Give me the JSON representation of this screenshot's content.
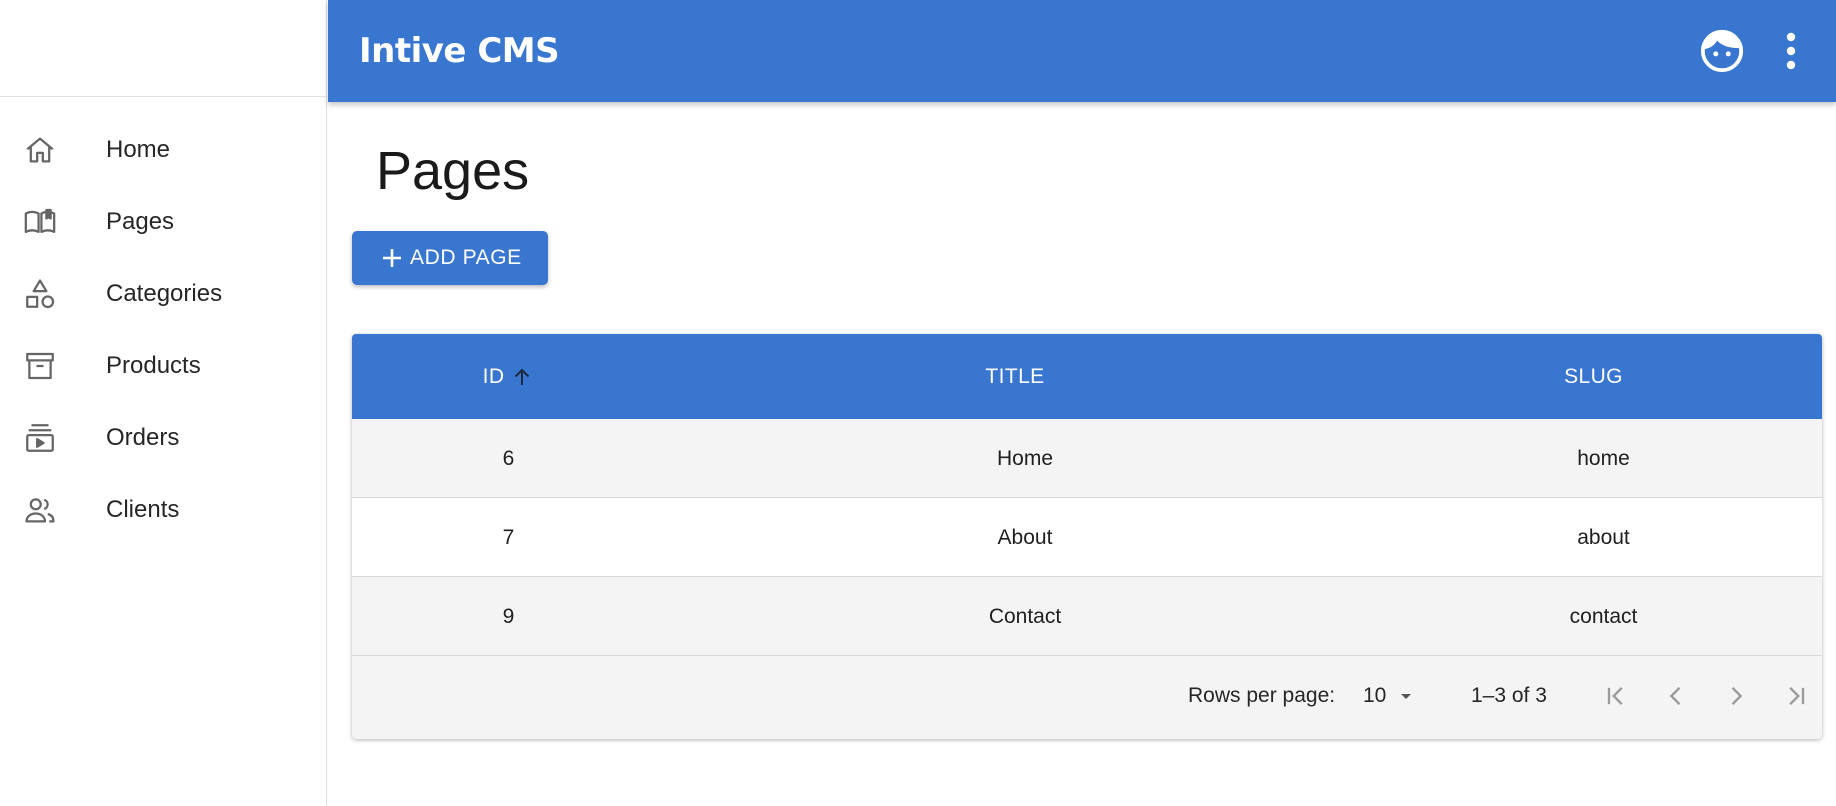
{
  "app": {
    "title": "Intive CMS"
  },
  "sidebar": {
    "items": [
      {
        "label": "Home",
        "icon": "home-icon"
      },
      {
        "label": "Pages",
        "icon": "book-icon"
      },
      {
        "label": "Categories",
        "icon": "shapes-icon"
      },
      {
        "label": "Products",
        "icon": "archive-icon"
      },
      {
        "label": "Orders",
        "icon": "subscriptions-icon"
      },
      {
        "label": "Clients",
        "icon": "people-icon"
      }
    ]
  },
  "main": {
    "title": "Pages",
    "add_button": "ADD PAGE"
  },
  "table": {
    "columns": [
      "ID",
      "TITLE",
      "SLUG"
    ],
    "sorted_by": "ID",
    "rows": [
      {
        "id": "6",
        "title": "Home",
        "slug": "home"
      },
      {
        "id": "7",
        "title": "About",
        "slug": "about"
      },
      {
        "id": "9",
        "title": "Contact",
        "slug": "contact"
      }
    ],
    "pagination": {
      "rows_per_page_label": "Rows per page:",
      "rows_per_page": "10",
      "range": "1–3 of 3"
    }
  },
  "colors": {
    "primary": "#3876cf",
    "row_alt": "#f4f4f4"
  }
}
